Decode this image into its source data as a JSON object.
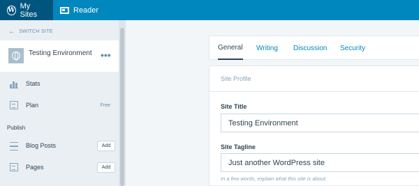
{
  "masterbar": {
    "my_sites": "My Sites",
    "reader": "Reader"
  },
  "sidebar": {
    "switch_site": "SWITCH SITE",
    "site_name": "Testing Environment",
    "more": "•••",
    "items": {
      "stats": "Stats",
      "plan": "Plan",
      "plan_badge": "Free",
      "blog_posts": "Blog Posts",
      "pages": "Pages",
      "add": "Add"
    },
    "publish_heading": "Publish"
  },
  "tabs": [
    "General",
    "Writing",
    "Discussion",
    "Security"
  ],
  "site_profile": {
    "header": "Site Profile",
    "title_label": "Site Title",
    "title_value": "Testing Environment",
    "tagline_label": "Site Tagline",
    "tagline_value": "Just another WordPress site",
    "tagline_hint": "In a few words, explain what this site is about."
  },
  "colors": {
    "masterbar": "#0087be",
    "masterbar_active": "#00557f",
    "link": "#0087be"
  }
}
